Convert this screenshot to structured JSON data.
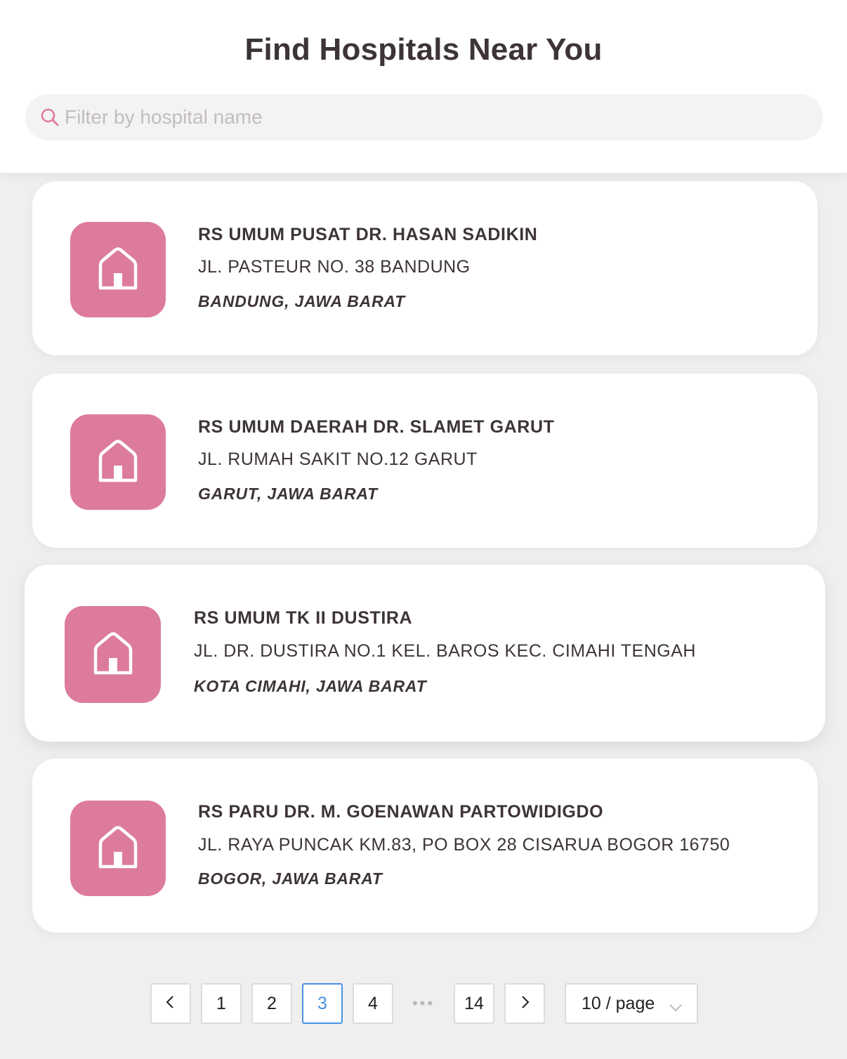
{
  "header": {
    "title": "Find Hospitals Near You",
    "search": {
      "placeholder": "Filter by hospital name",
      "value": ""
    }
  },
  "accent_color": "#dd7b9c",
  "active_page_color": "#4a90e2",
  "hospitals": [
    {
      "name": "RS UMUM PUSAT DR. HASAN SADIKIN",
      "address": "JL. PASTEUR NO. 38 BANDUNG",
      "region": "BANDUNG, JAWA BARAT",
      "icon": "house-icon"
    },
    {
      "name": "RS UMUM DAERAH DR. SLAMET GARUT",
      "address": "JL. RUMAH SAKIT NO.12 GARUT",
      "region": "GARUT, JAWA BARAT",
      "icon": "house-icon"
    },
    {
      "name": "RS UMUM TK II DUSTIRA",
      "address": "JL. DR. DUSTIRA NO.1 KEL. BAROS KEC. CIMAHI TENGAH",
      "region": "KOTA CIMAHI, JAWA BARAT",
      "icon": "house-icon"
    },
    {
      "name": "RS PARU DR. M. GOENAWAN PARTOWIDIGDO",
      "address": "JL. RAYA PUNCAK KM.83, PO BOX 28 CISARUA BOGOR 16750",
      "region": "BOGOR, JAWA BARAT",
      "icon": "house-icon"
    }
  ],
  "pagination": {
    "prev_icon": "chevron-left-icon",
    "next_icon": "chevron-right-icon",
    "pages": [
      "1",
      "2",
      "3",
      "4"
    ],
    "ellipsis": "•••",
    "last_page": "14",
    "current_page": "3",
    "page_size_label": "10 / page"
  }
}
